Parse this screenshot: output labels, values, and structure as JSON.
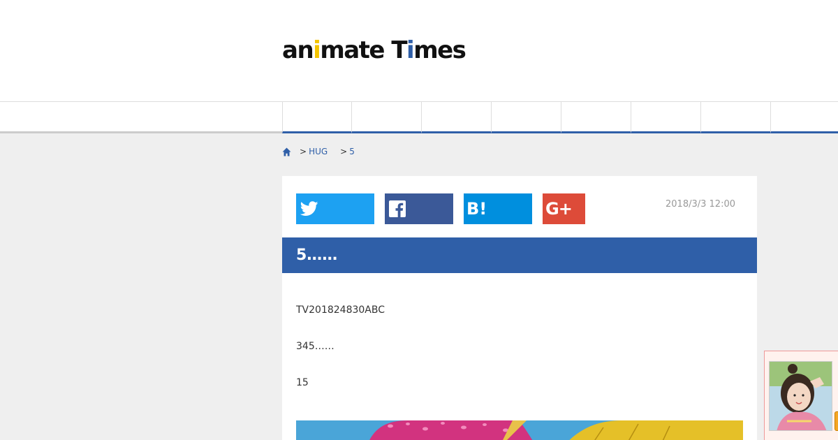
{
  "logo": {
    "part1": "an",
    "i1": "i",
    "part2": "mate T",
    "i2": "i",
    "part3": "mes",
    "accent_yellow": "#f4c400",
    "accent_blue": "#2f5fa8"
  },
  "nav": {
    "item_count": 8
  },
  "breadcrumb": {
    "home_icon": "home-icon",
    "items": [
      {
        "sep": ">",
        "label": "HUG"
      },
      {
        "sep": ">",
        "label": "5"
      }
    ]
  },
  "share": {
    "twitter_icon": "twitter-icon",
    "facebook_icon": "facebook-icon",
    "hatena_label": "B!",
    "google_plus_label": "G+"
  },
  "article": {
    "date": "2018/3/3 12:00",
    "title": "5……",
    "paragraphs": [
      "TV201824830ABC",
      "345……",
      "15"
    ]
  },
  "colors": {
    "brand_blue": "#2f5fa8",
    "twitter": "#1da1f2",
    "facebook": "#3b5998",
    "hatena": "#008fde",
    "google_plus": "#dd4b39"
  }
}
